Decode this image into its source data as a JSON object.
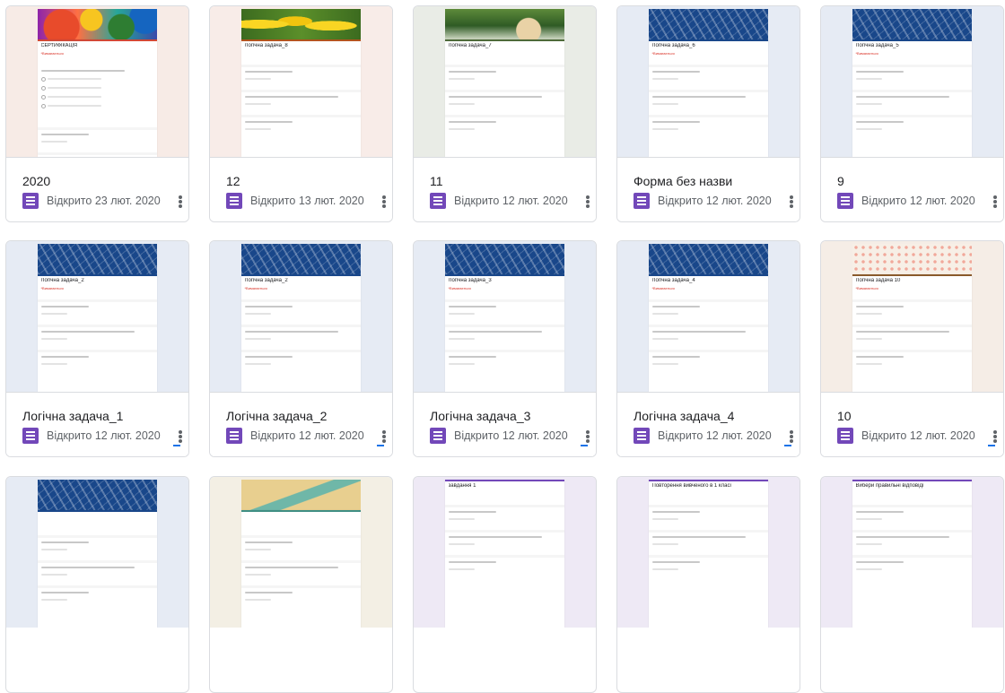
{
  "colors": {
    "forms_icon": "#7248b9",
    "card_border": "#dadce0",
    "title_text": "#202124",
    "meta_text": "#5f6368"
  },
  "icons": {
    "form_type": "google-forms-icon",
    "more": "more-vert-icon"
  },
  "cards": [
    {
      "title": "2020",
      "opened": "Відкрито 23 лют. 2020",
      "theme": "pencils",
      "preview_title": "СЕРТИФІКАЦІЯ",
      "preview_required": "*Вимагається"
    },
    {
      "title": "12",
      "opened": "Відкрито 13 лют. 2020",
      "theme": "lemons",
      "preview_title": "Логічна задача_8",
      "preview_required": ""
    },
    {
      "title": "11",
      "opened": "Відкрито 12 лют. 2020",
      "theme": "garden",
      "preview_title": "Логічна задача_7",
      "preview_required": ""
    },
    {
      "title": "Форма без назви",
      "opened": "Відкрито 12 лют. 2020",
      "theme": "numbers",
      "preview_title": "Логічна задача_6",
      "preview_required": "*Вимагається"
    },
    {
      "title": "9",
      "opened": "Відкрито 12 лют. 2020",
      "theme": "numbers",
      "preview_title": "Логічна задача_5",
      "preview_required": "*Вимагається"
    },
    {
      "title": "Логічна задача_1",
      "opened": "Відкрито 12 лют. 2020",
      "theme": "numbers",
      "preview_title": "Логічна задача_2",
      "preview_required": "*Вимагається"
    },
    {
      "title": "Логічна задача_2",
      "opened": "Відкрито 12 лют. 2020",
      "theme": "numbers",
      "preview_title": "Логічна задача_2",
      "preview_required": "*Вимагається"
    },
    {
      "title": "Логічна задача_3",
      "opened": "Відкрито 12 лют. 2020",
      "theme": "numbers",
      "preview_title": "Логічна задача_3",
      "preview_required": "*Вимагається"
    },
    {
      "title": "Логічна задача_4",
      "opened": "Відкрито 12 лют. 2020",
      "theme": "numbers",
      "preview_title": "Логічна задача_4",
      "preview_required": "*Вимагається"
    },
    {
      "title": "10",
      "opened": "Відкрито 12 лют. 2020",
      "theme": "dots",
      "preview_title": "Логічна задача 10",
      "preview_required": "*Вимагається"
    },
    {
      "title": "",
      "opened": "",
      "theme": "numbers",
      "preview_title": "",
      "preview_required": ""
    },
    {
      "title": "",
      "opened": "",
      "theme": "beach",
      "preview_title": "",
      "preview_required": ""
    },
    {
      "title": "",
      "opened": "",
      "theme": "plain",
      "preview_title": "завдання 1",
      "preview_required": ""
    },
    {
      "title": "",
      "opened": "",
      "theme": "plain",
      "preview_title": "Повторення вивченого в 1 класі",
      "preview_required": ""
    },
    {
      "title": "",
      "opened": "",
      "theme": "plain",
      "preview_title": "Вибери правильні відповіді",
      "preview_required": ""
    }
  ]
}
